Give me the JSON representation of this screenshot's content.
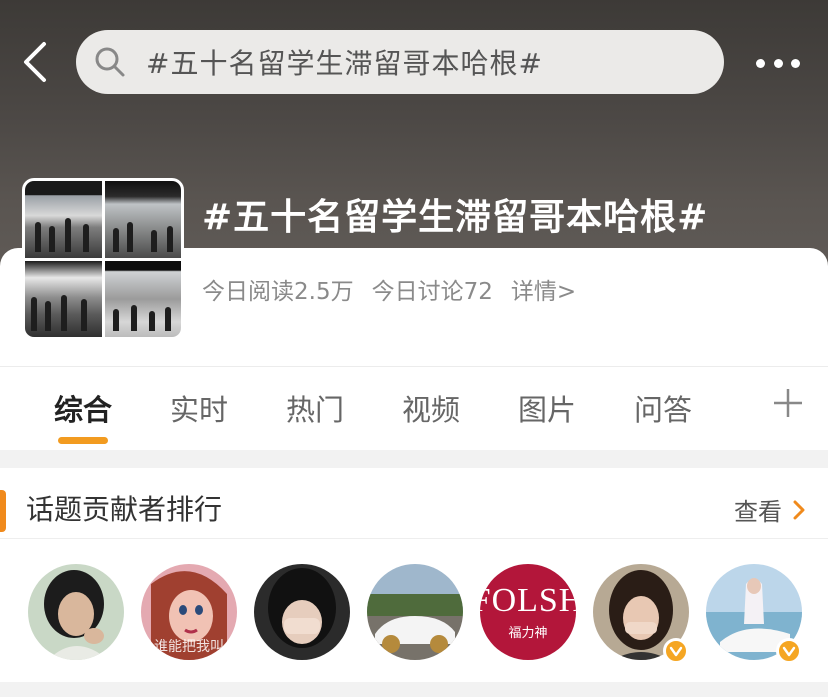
{
  "header": {
    "search_text": "#五十名留学生滞留哥本哈根#",
    "back_icon": "chevron-left-icon",
    "more_icon": "more-dots-icon"
  },
  "topic": {
    "title": "#五十名留学生滞留哥本哈根#",
    "reads_today": "今日阅读2.5万",
    "discussions_today": "今日讨论72",
    "details_link": "详情>"
  },
  "tabs": [
    {
      "label": "综合",
      "active": true
    },
    {
      "label": "实时",
      "active": false
    },
    {
      "label": "热门",
      "active": false
    },
    {
      "label": "视频",
      "active": false
    },
    {
      "label": "图片",
      "active": false
    },
    {
      "label": "问答",
      "active": false
    }
  ],
  "contributors": {
    "title": "话题贡献者排行",
    "view_label": "查看",
    "avatars": [
      {
        "verified": false
      },
      {
        "verified": false,
        "caption": "谁能把我叫"
      },
      {
        "verified": false
      },
      {
        "verified": false
      },
      {
        "verified": false,
        "brand": "FOLSH",
        "brand_sub": "福力神"
      },
      {
        "verified": true
      },
      {
        "verified": true
      }
    ]
  },
  "colors": {
    "accent": "#f29b20",
    "section_marker": "#f08a1c",
    "verified_badge": "#f5a623"
  }
}
